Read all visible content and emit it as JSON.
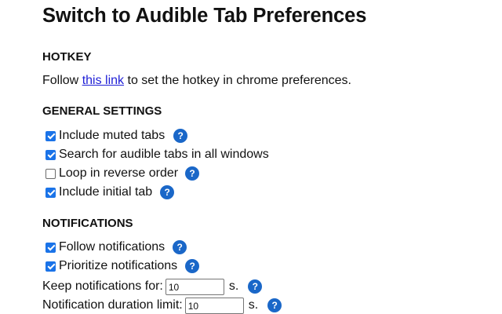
{
  "title": "Switch to Audible Tab Preferences",
  "hotkey": {
    "heading": "HOTKEY",
    "text_before": "Follow",
    "link_text": "this link",
    "text_after": "to set the hotkey in chrome preferences."
  },
  "general": {
    "heading": "GENERAL SETTINGS",
    "items": [
      {
        "label": "Include muted tabs",
        "checked": true,
        "help": true
      },
      {
        "label": "Search for audible tabs in all windows",
        "checked": true,
        "help": false
      },
      {
        "label": "Loop in reverse order",
        "checked": false,
        "help": true
      },
      {
        "label": "Include initial tab",
        "checked": true,
        "help": true
      }
    ]
  },
  "notifications": {
    "heading": "NOTIFICATIONS",
    "items": [
      {
        "label": "Follow notifications",
        "checked": true,
        "help": true
      },
      {
        "label": "Prioritize notifications",
        "checked": true,
        "help": true
      }
    ],
    "keep_label": "Keep notifications for:",
    "keep_value": "10",
    "keep_unit": "s.",
    "duration_label": "Notification duration limit:",
    "duration_value": "10",
    "duration_unit": "s."
  },
  "help_glyph": "?",
  "icons": {
    "help": "question-mark-icon"
  },
  "colors": {
    "accent": "#1a73e8",
    "help_badge": "#1a67c8",
    "link": "#1f1fd6"
  }
}
